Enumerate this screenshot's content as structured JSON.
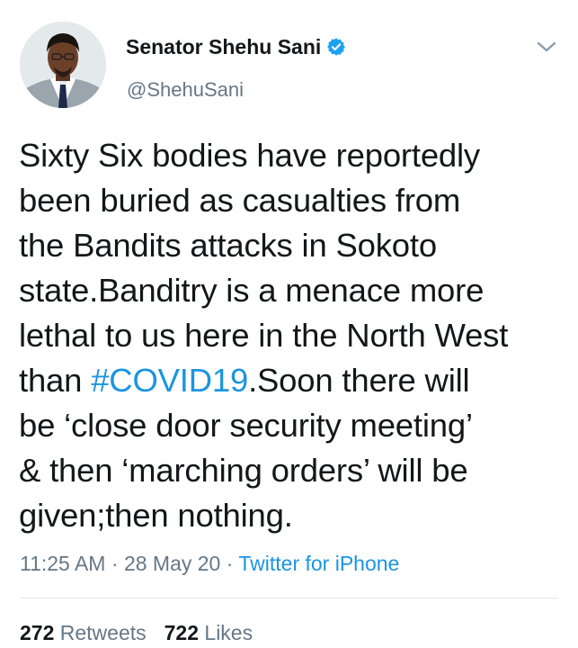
{
  "author": {
    "display_name": "Senator Shehu Sani",
    "handle": "@ShehuSani",
    "verified_icon": "verified-badge-icon",
    "avatar_icon": "profile-photo"
  },
  "menu_icon": "chevron-down-icon",
  "tweet": {
    "lines": [
      [
        "Sixty Six bodies have reportedly"
      ],
      [
        "been buried as casualties from"
      ],
      [
        "the Bandits attacks in Sokoto"
      ],
      [
        "state.Banditry is a menace more"
      ],
      [
        "lethal to us here in the North West"
      ],
      [
        "than ",
        "#COVID19",
        ".Soon there will"
      ],
      [
        "be ‘close door security meeting’"
      ],
      [
        "& then ‘marching orders’ will be"
      ],
      [
        "given;then nothing."
      ]
    ],
    "hashtag": "#COVID19"
  },
  "meta": {
    "time": "11:25 AM",
    "separator": " · ",
    "date": "28 May 20",
    "source": "Twitter for iPhone"
  },
  "stats": {
    "retweets_count": "272",
    "retweets_label": "Retweets",
    "likes_count": "722",
    "likes_label": "Likes"
  },
  "colors": {
    "link": "#1b95e0",
    "secondary_text": "#657786",
    "verified": "#1da1f2"
  }
}
